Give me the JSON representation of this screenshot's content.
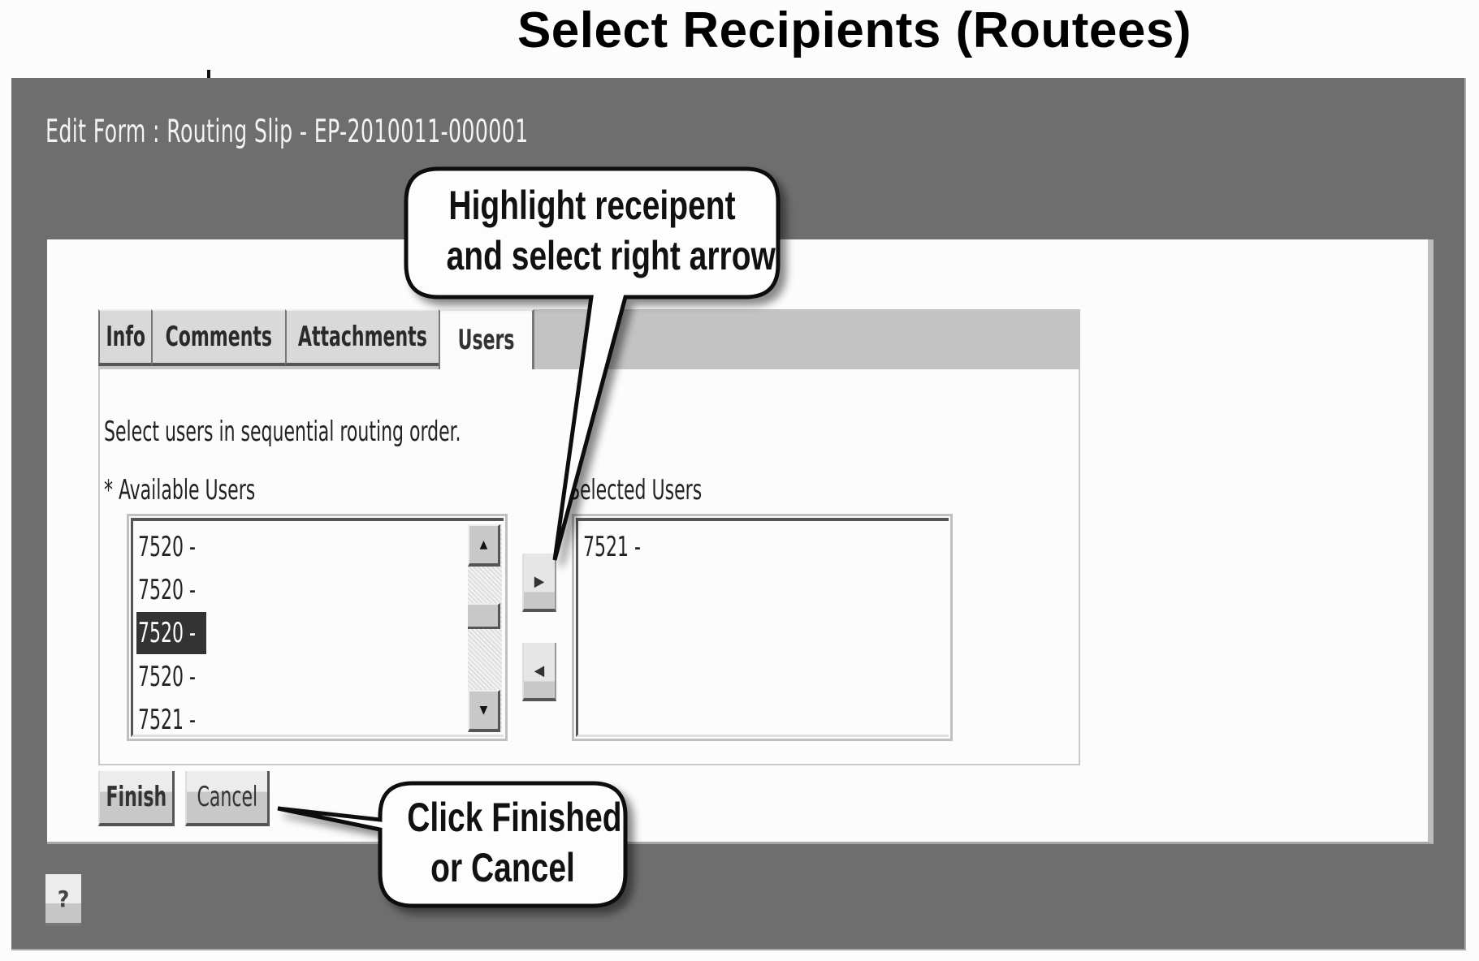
{
  "slide": {
    "title": "Select Recipients (Routees)"
  },
  "window": {
    "header": "Edit Form :  Routing Slip - EP-2010011-000001"
  },
  "tabs": [
    {
      "label": "Info",
      "active": false
    },
    {
      "label": "Comments",
      "active": false
    },
    {
      "label": "Attachments",
      "active": false
    },
    {
      "label": "Users",
      "active": true
    }
  ],
  "users_tab": {
    "instruction": "Select  users in sequential routing order.",
    "available_label": "* Available Users",
    "selected_label": "Selected Users",
    "available_users": [
      {
        "label": "7520 -",
        "selected": false
      },
      {
        "label": "7520 -",
        "selected": false
      },
      {
        "label": "7520 -",
        "selected": true
      },
      {
        "label": "7520 -",
        "selected": false
      },
      {
        "label": "7521 -",
        "selected": false
      }
    ],
    "selected_users": [
      {
        "label": "7521 -"
      }
    ],
    "move_right_icon": "▶",
    "move_left_icon": "◀",
    "scroll_up_icon": "▲",
    "scroll_down_icon": "▼"
  },
  "actions": {
    "finish_label": "Finish",
    "cancel_label": "Cancel",
    "help_label": "?"
  },
  "callouts": {
    "arrow_hint": {
      "line1": "Highlight receipent",
      "line2": "and select right arrow"
    },
    "finish_hint": {
      "line1": "Click Finished",
      "line2": "or Cancel"
    }
  },
  "colors": {
    "window_bg": "#6e6e6e",
    "panel_bg": "#fcfcfc",
    "tab_bar": "#c3c3c3",
    "selection": "#333333"
  }
}
